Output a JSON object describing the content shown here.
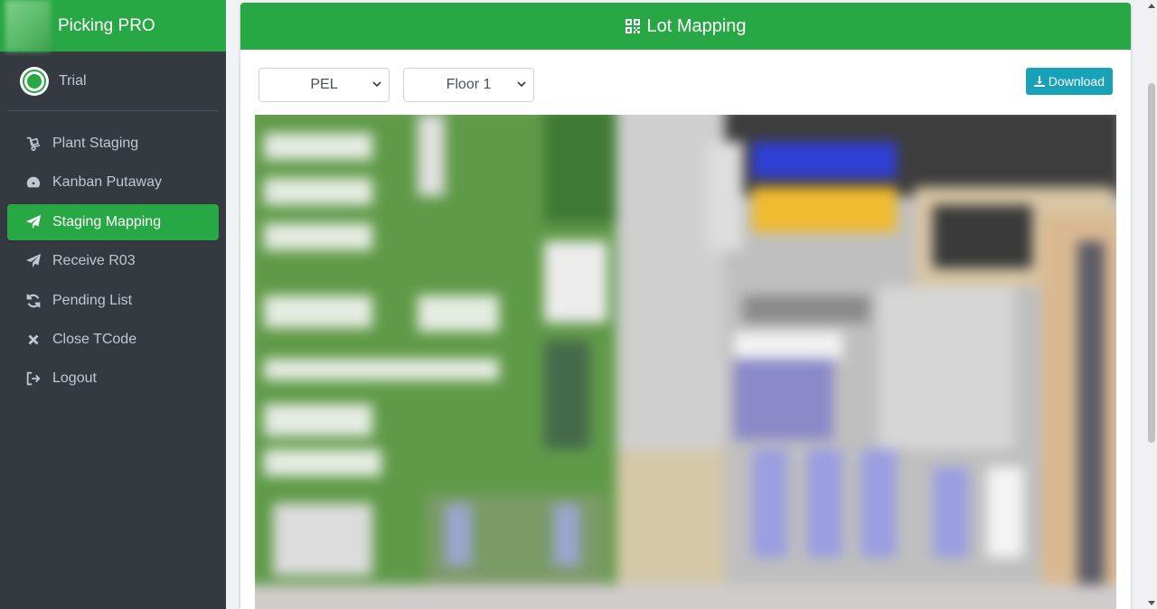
{
  "app": {
    "brand": "Picking PRO"
  },
  "user": {
    "name": "Trial"
  },
  "sidebar": {
    "items": [
      {
        "label": "Plant Staging",
        "icon": "dolly-icon",
        "active": false
      },
      {
        "label": "Kanban Putaway",
        "icon": "gauge-icon",
        "active": false
      },
      {
        "label": "Staging Mapping",
        "icon": "paper-plane-icon",
        "active": true
      },
      {
        "label": "Receive R03",
        "icon": "paper-plane-icon",
        "active": false
      },
      {
        "label": "Pending List",
        "icon": "sync-icon",
        "active": false
      },
      {
        "label": "Close TCode",
        "icon": "close-icon",
        "active": false
      },
      {
        "label": "Logout",
        "icon": "logout-icon",
        "active": false
      }
    ]
  },
  "main": {
    "title": "Lot Mapping",
    "plant_select": "PEL",
    "floor_select": "Floor 1",
    "download_label": "Download"
  },
  "colors": {
    "accent": "#28a745",
    "sidebar_bg": "#343a40",
    "info": "#17a2b8"
  }
}
